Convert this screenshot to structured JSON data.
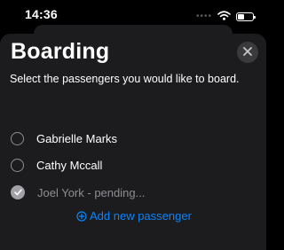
{
  "status_bar": {
    "time": "14:36",
    "dots": "••••",
    "battery_level": 0.45,
    "icons": [
      "signal-dots-icon",
      "wifi-icon",
      "battery-icon"
    ]
  },
  "sheet": {
    "title": "Boarding",
    "subtitle": "Select the passengers you would like to board.",
    "passengers": [
      {
        "name": "Gabrielle Marks",
        "selected": false,
        "pending": false
      },
      {
        "name": "Cathy Mccall",
        "selected": false,
        "pending": false
      },
      {
        "name": "Joel York - pending...",
        "selected": true,
        "pending": true
      }
    ],
    "add_label": "Add new passenger",
    "close_icon": "close-icon"
  },
  "colors": {
    "background": "#000000",
    "sheet": "#1c1c1e",
    "accent": "#0a84ff",
    "muted_text": "#8e8e93"
  }
}
